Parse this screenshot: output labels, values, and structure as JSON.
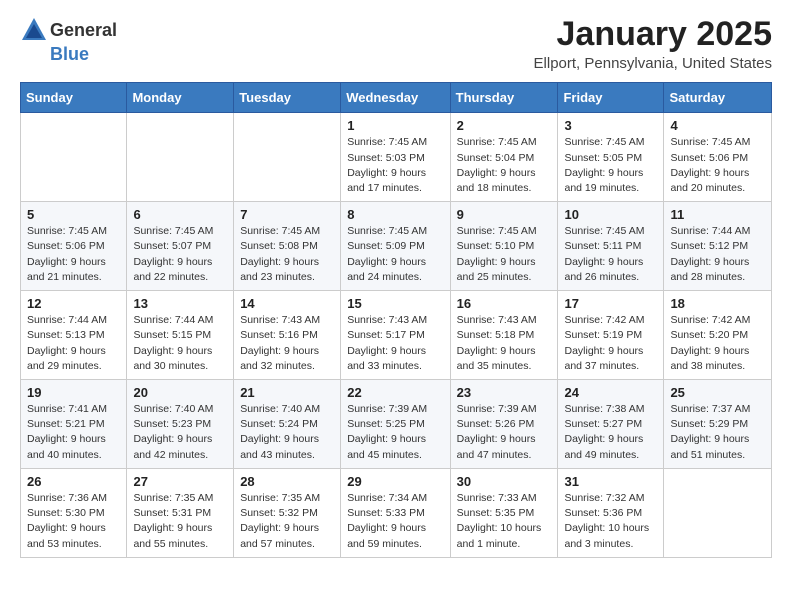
{
  "header": {
    "logo_general": "General",
    "logo_blue": "Blue",
    "title": "January 2025",
    "location": "Ellport, Pennsylvania, United States"
  },
  "weekdays": [
    "Sunday",
    "Monday",
    "Tuesday",
    "Wednesday",
    "Thursday",
    "Friday",
    "Saturday"
  ],
  "weeks": [
    [
      {
        "day": "",
        "sunrise": "",
        "sunset": "",
        "daylight": ""
      },
      {
        "day": "",
        "sunrise": "",
        "sunset": "",
        "daylight": ""
      },
      {
        "day": "",
        "sunrise": "",
        "sunset": "",
        "daylight": ""
      },
      {
        "day": "1",
        "sunrise": "Sunrise: 7:45 AM",
        "sunset": "Sunset: 5:03 PM",
        "daylight": "Daylight: 9 hours and 17 minutes."
      },
      {
        "day": "2",
        "sunrise": "Sunrise: 7:45 AM",
        "sunset": "Sunset: 5:04 PM",
        "daylight": "Daylight: 9 hours and 18 minutes."
      },
      {
        "day": "3",
        "sunrise": "Sunrise: 7:45 AM",
        "sunset": "Sunset: 5:05 PM",
        "daylight": "Daylight: 9 hours and 19 minutes."
      },
      {
        "day": "4",
        "sunrise": "Sunrise: 7:45 AM",
        "sunset": "Sunset: 5:06 PM",
        "daylight": "Daylight: 9 hours and 20 minutes."
      }
    ],
    [
      {
        "day": "5",
        "sunrise": "Sunrise: 7:45 AM",
        "sunset": "Sunset: 5:06 PM",
        "daylight": "Daylight: 9 hours and 21 minutes."
      },
      {
        "day": "6",
        "sunrise": "Sunrise: 7:45 AM",
        "sunset": "Sunset: 5:07 PM",
        "daylight": "Daylight: 9 hours and 22 minutes."
      },
      {
        "day": "7",
        "sunrise": "Sunrise: 7:45 AM",
        "sunset": "Sunset: 5:08 PM",
        "daylight": "Daylight: 9 hours and 23 minutes."
      },
      {
        "day": "8",
        "sunrise": "Sunrise: 7:45 AM",
        "sunset": "Sunset: 5:09 PM",
        "daylight": "Daylight: 9 hours and 24 minutes."
      },
      {
        "day": "9",
        "sunrise": "Sunrise: 7:45 AM",
        "sunset": "Sunset: 5:10 PM",
        "daylight": "Daylight: 9 hours and 25 minutes."
      },
      {
        "day": "10",
        "sunrise": "Sunrise: 7:45 AM",
        "sunset": "Sunset: 5:11 PM",
        "daylight": "Daylight: 9 hours and 26 minutes."
      },
      {
        "day": "11",
        "sunrise": "Sunrise: 7:44 AM",
        "sunset": "Sunset: 5:12 PM",
        "daylight": "Daylight: 9 hours and 28 minutes."
      }
    ],
    [
      {
        "day": "12",
        "sunrise": "Sunrise: 7:44 AM",
        "sunset": "Sunset: 5:13 PM",
        "daylight": "Daylight: 9 hours and 29 minutes."
      },
      {
        "day": "13",
        "sunrise": "Sunrise: 7:44 AM",
        "sunset": "Sunset: 5:15 PM",
        "daylight": "Daylight: 9 hours and 30 minutes."
      },
      {
        "day": "14",
        "sunrise": "Sunrise: 7:43 AM",
        "sunset": "Sunset: 5:16 PM",
        "daylight": "Daylight: 9 hours and 32 minutes."
      },
      {
        "day": "15",
        "sunrise": "Sunrise: 7:43 AM",
        "sunset": "Sunset: 5:17 PM",
        "daylight": "Daylight: 9 hours and 33 minutes."
      },
      {
        "day": "16",
        "sunrise": "Sunrise: 7:43 AM",
        "sunset": "Sunset: 5:18 PM",
        "daylight": "Daylight: 9 hours and 35 minutes."
      },
      {
        "day": "17",
        "sunrise": "Sunrise: 7:42 AM",
        "sunset": "Sunset: 5:19 PM",
        "daylight": "Daylight: 9 hours and 37 minutes."
      },
      {
        "day": "18",
        "sunrise": "Sunrise: 7:42 AM",
        "sunset": "Sunset: 5:20 PM",
        "daylight": "Daylight: 9 hours and 38 minutes."
      }
    ],
    [
      {
        "day": "19",
        "sunrise": "Sunrise: 7:41 AM",
        "sunset": "Sunset: 5:21 PM",
        "daylight": "Daylight: 9 hours and 40 minutes."
      },
      {
        "day": "20",
        "sunrise": "Sunrise: 7:40 AM",
        "sunset": "Sunset: 5:23 PM",
        "daylight": "Daylight: 9 hours and 42 minutes."
      },
      {
        "day": "21",
        "sunrise": "Sunrise: 7:40 AM",
        "sunset": "Sunset: 5:24 PM",
        "daylight": "Daylight: 9 hours and 43 minutes."
      },
      {
        "day": "22",
        "sunrise": "Sunrise: 7:39 AM",
        "sunset": "Sunset: 5:25 PM",
        "daylight": "Daylight: 9 hours and 45 minutes."
      },
      {
        "day": "23",
        "sunrise": "Sunrise: 7:39 AM",
        "sunset": "Sunset: 5:26 PM",
        "daylight": "Daylight: 9 hours and 47 minutes."
      },
      {
        "day": "24",
        "sunrise": "Sunrise: 7:38 AM",
        "sunset": "Sunset: 5:27 PM",
        "daylight": "Daylight: 9 hours and 49 minutes."
      },
      {
        "day": "25",
        "sunrise": "Sunrise: 7:37 AM",
        "sunset": "Sunset: 5:29 PM",
        "daylight": "Daylight: 9 hours and 51 minutes."
      }
    ],
    [
      {
        "day": "26",
        "sunrise": "Sunrise: 7:36 AM",
        "sunset": "Sunset: 5:30 PM",
        "daylight": "Daylight: 9 hours and 53 minutes."
      },
      {
        "day": "27",
        "sunrise": "Sunrise: 7:35 AM",
        "sunset": "Sunset: 5:31 PM",
        "daylight": "Daylight: 9 hours and 55 minutes."
      },
      {
        "day": "28",
        "sunrise": "Sunrise: 7:35 AM",
        "sunset": "Sunset: 5:32 PM",
        "daylight": "Daylight: 9 hours and 57 minutes."
      },
      {
        "day": "29",
        "sunrise": "Sunrise: 7:34 AM",
        "sunset": "Sunset: 5:33 PM",
        "daylight": "Daylight: 9 hours and 59 minutes."
      },
      {
        "day": "30",
        "sunrise": "Sunrise: 7:33 AM",
        "sunset": "Sunset: 5:35 PM",
        "daylight": "Daylight: 10 hours and 1 minute."
      },
      {
        "day": "31",
        "sunrise": "Sunrise: 7:32 AM",
        "sunset": "Sunset: 5:36 PM",
        "daylight": "Daylight: 10 hours and 3 minutes."
      },
      {
        "day": "",
        "sunrise": "",
        "sunset": "",
        "daylight": ""
      }
    ]
  ]
}
